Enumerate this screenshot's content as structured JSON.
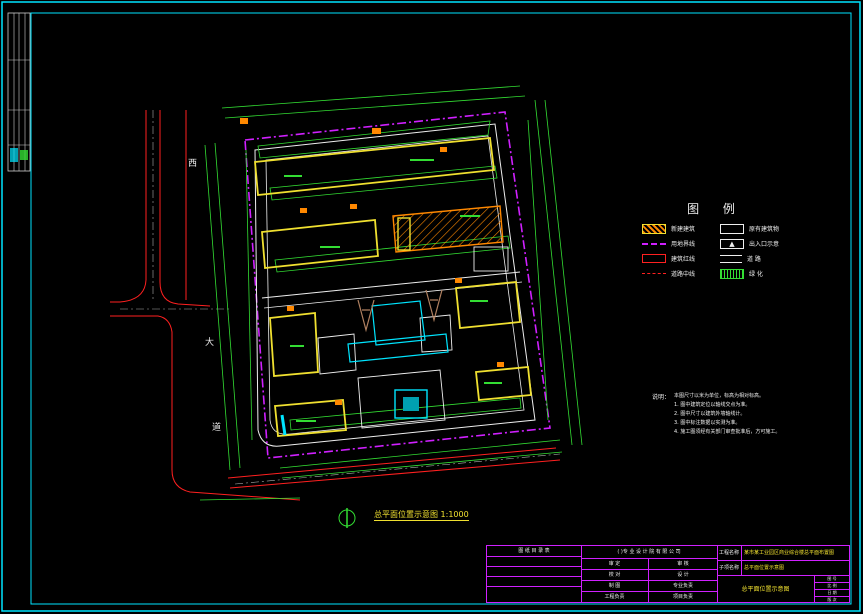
{
  "road_labels": {
    "west_top": "西",
    "west_mid": "大",
    "west_bottom": "道"
  },
  "plan_title": "总平面位置示意图 1:1000",
  "legend": {
    "title": "图  例",
    "items_left": [
      {
        "swatch": "hatched-yellow",
        "label": "新建建筑"
      },
      {
        "swatch": "magenta-dash",
        "label": "用地界线"
      },
      {
        "swatch": "red-line",
        "label": "建筑红线"
      },
      {
        "swatch": "red-dash",
        "label": "道路中线"
      }
    ],
    "items_right": [
      {
        "swatch": "white-box",
        "label": "原有建筑物"
      },
      {
        "swatch": "entrance",
        "label": "出入口示意"
      },
      {
        "swatch": "road",
        "label": "道  路"
      },
      {
        "swatch": "green",
        "label": "绿  化"
      }
    ]
  },
  "notes": {
    "heading": "说明：",
    "lines": [
      "本图尺寸以米为单位，标高为相对标高。",
      "1.  图中建筑定位以轴线交点为准。",
      "2.  图中尺寸以建筑外墙轴线计。",
      "3.  图中标注数据以实测为准。",
      "4.  施工图须经有关部门审查批准后，方可施工。"
    ]
  },
  "title_block": {
    "left_header": "图 纸 目 录 表",
    "institute": "(  )专 业 设 计 院 有 限 公 司",
    "project_label": "工程名称",
    "project_name": "某市某工业园区商业综合楼总平面布置图",
    "subproject_label": "子项名称",
    "subproject_name": "总平面位置示意图",
    "drawing_name": "总平面位置示意图",
    "fields": [
      "审 定",
      "审 核",
      "校 对",
      "设 计",
      "制 图",
      "专业负责",
      "工程负责",
      "项目负责"
    ],
    "meta": [
      "图 号",
      "比 例",
      "日 期",
      "版 次"
    ]
  },
  "colors": {
    "frame": "#00e5ff",
    "boundary": "#d020ff",
    "green": "#33dd33",
    "yellow": "#f0e030",
    "red": "#ff2020",
    "orange": "#ff8800",
    "white": "#ffffff",
    "cyan": "#00e5ff"
  }
}
